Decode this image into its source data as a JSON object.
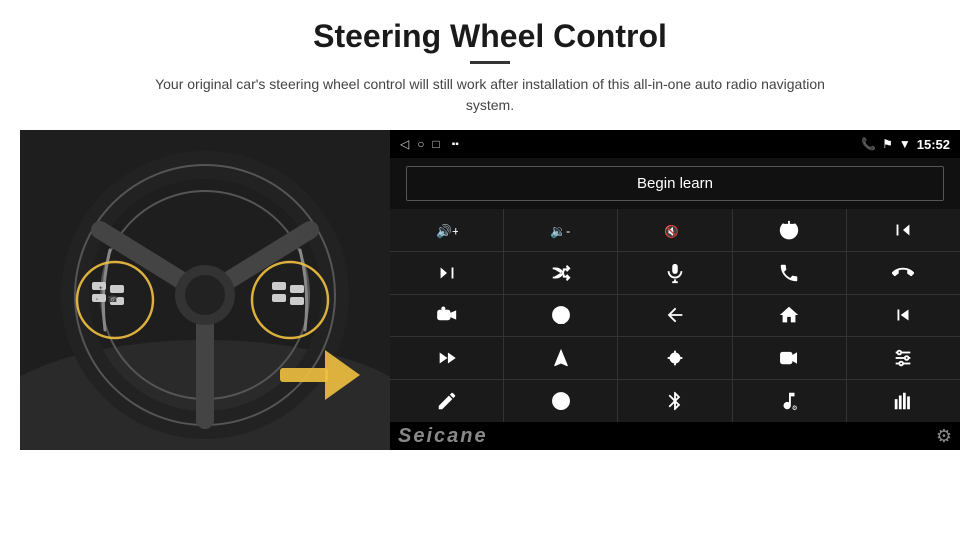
{
  "header": {
    "title": "Steering Wheel Control",
    "divider": true,
    "subtitle": "Your original car's steering wheel control will still work after installation of this all-in-one auto radio navigation system."
  },
  "statusBar": {
    "time": "15:52",
    "navIcons": [
      "◁",
      "○",
      "□"
    ],
    "rightIcons": [
      "📞",
      "⚑",
      "▼"
    ]
  },
  "beginLearn": {
    "label": "Begin learn"
  },
  "controls": [
    {
      "id": "vol-up",
      "icon": "vol_up"
    },
    {
      "id": "vol-down",
      "icon": "vol_down"
    },
    {
      "id": "mute",
      "icon": "mute"
    },
    {
      "id": "power",
      "icon": "power"
    },
    {
      "id": "prev-track-phone",
      "icon": "prev_phone"
    },
    {
      "id": "next-track",
      "icon": "next"
    },
    {
      "id": "shuffle",
      "icon": "shuffle"
    },
    {
      "id": "mic",
      "icon": "mic"
    },
    {
      "id": "phone",
      "icon": "phone"
    },
    {
      "id": "hang-up",
      "icon": "hang_up"
    },
    {
      "id": "speaker",
      "icon": "speaker"
    },
    {
      "id": "camera360",
      "icon": "camera360"
    },
    {
      "id": "back",
      "icon": "back"
    },
    {
      "id": "home",
      "icon": "home"
    },
    {
      "id": "prev-chapter",
      "icon": "prev_chapter"
    },
    {
      "id": "fast-forward",
      "icon": "fast_fwd"
    },
    {
      "id": "navigate",
      "icon": "navigate"
    },
    {
      "id": "eq",
      "icon": "eq"
    },
    {
      "id": "record",
      "icon": "record"
    },
    {
      "id": "settings-eq",
      "icon": "settings_eq"
    },
    {
      "id": "pen",
      "icon": "pen"
    },
    {
      "id": "360view",
      "icon": "view360"
    },
    {
      "id": "bluetooth",
      "icon": "bluetooth"
    },
    {
      "id": "music-settings",
      "icon": "music_settings"
    },
    {
      "id": "equalizer",
      "icon": "equalizer"
    }
  ],
  "watermark": {
    "text": "Seicane"
  }
}
